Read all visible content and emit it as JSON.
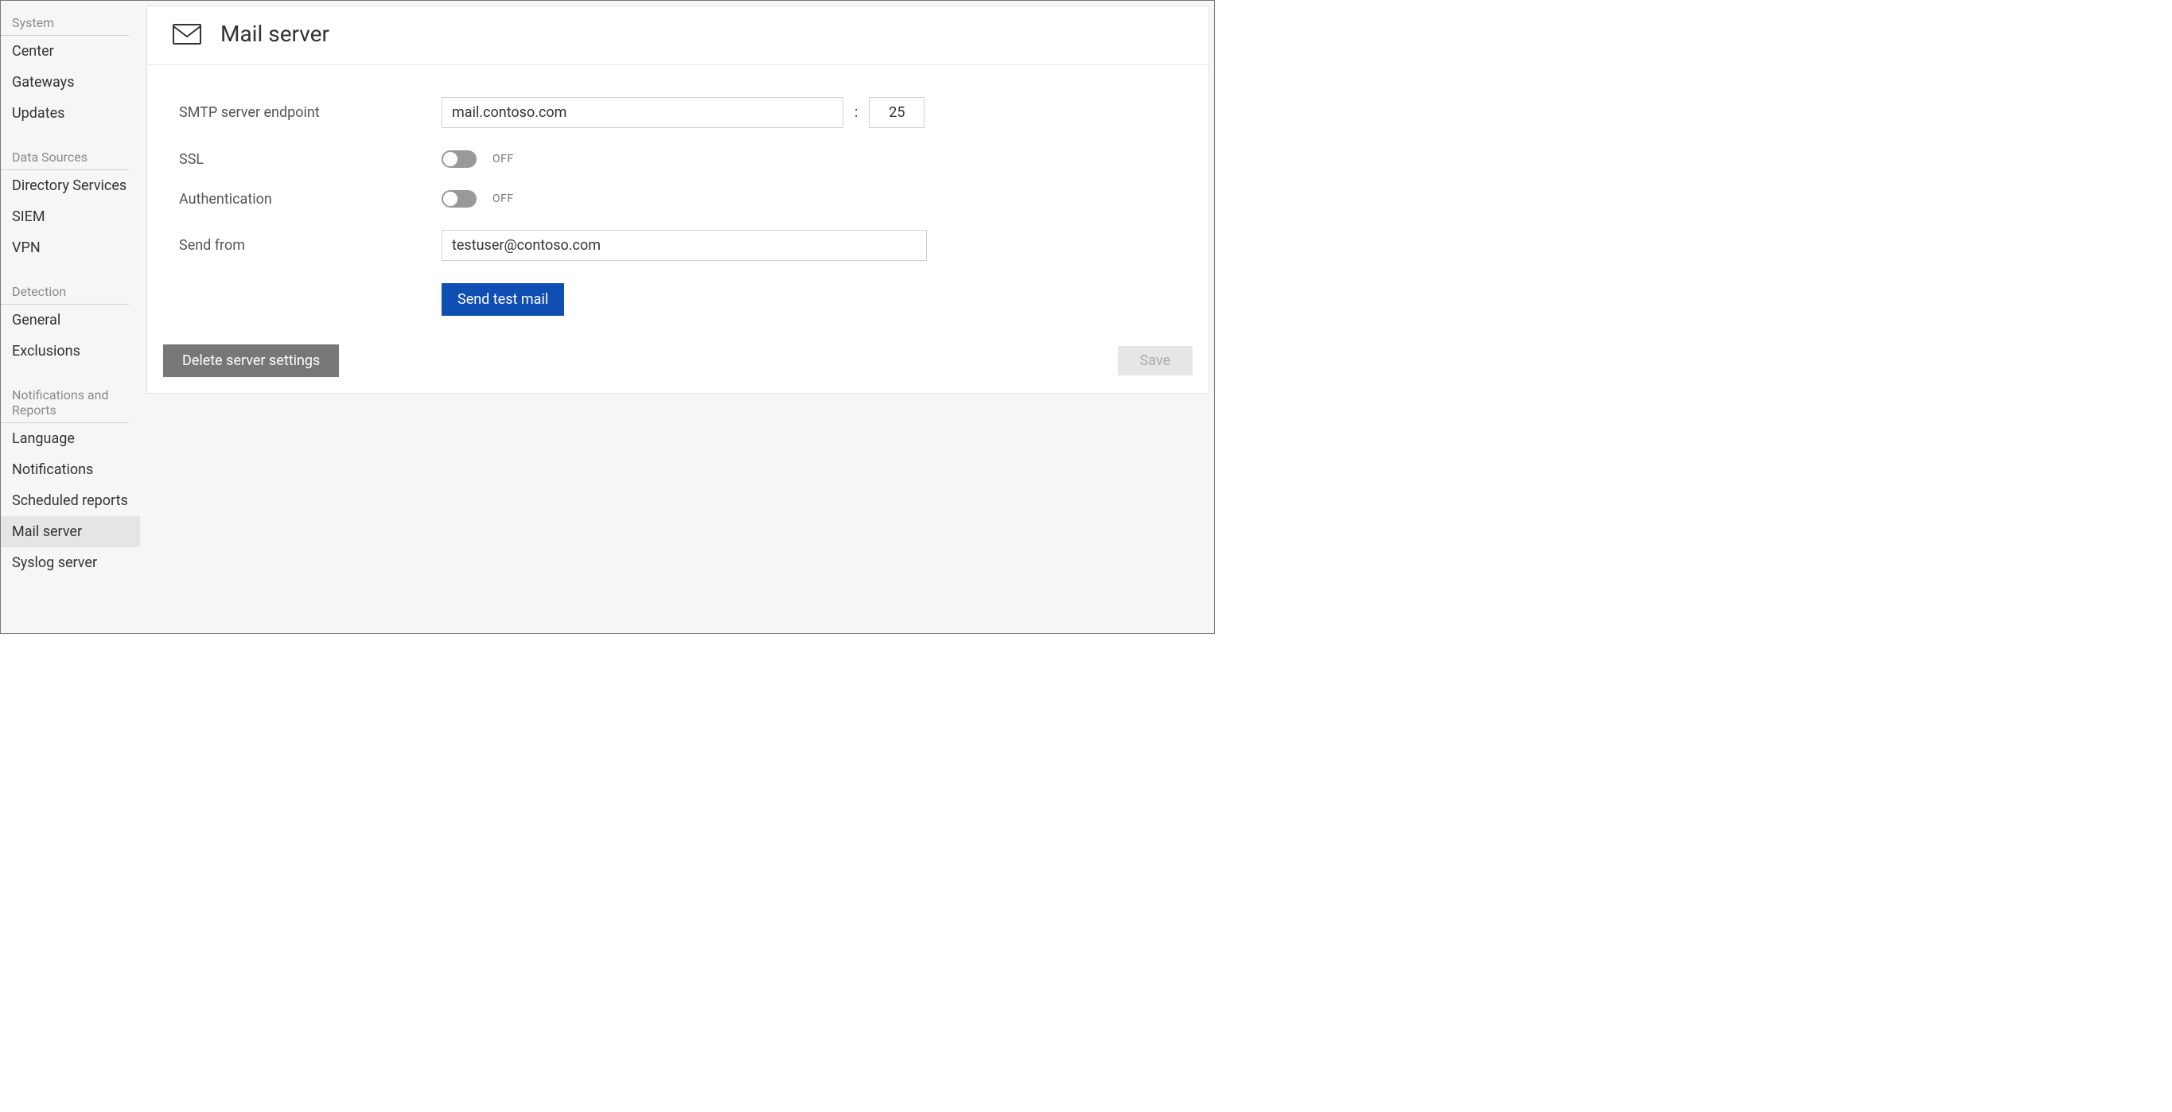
{
  "sidebar": {
    "groups": [
      {
        "title": "System",
        "items": [
          "Center",
          "Gateways",
          "Updates"
        ]
      },
      {
        "title": "Data Sources",
        "items": [
          "Directory Services",
          "SIEM",
          "VPN"
        ]
      },
      {
        "title": "Detection",
        "items": [
          "General",
          "Exclusions"
        ]
      },
      {
        "title": "Notifications and Reports",
        "items": [
          "Language",
          "Notifications",
          "Scheduled reports",
          "Mail server",
          "Syslog server"
        ]
      }
    ],
    "active": "Mail server"
  },
  "page": {
    "title": "Mail server",
    "labels": {
      "smtp": "SMTP server endpoint",
      "ssl": "SSL",
      "auth": "Authentication",
      "sendfrom": "Send from"
    },
    "values": {
      "smtp_host": "mail.contoso.com",
      "smtp_port": "25",
      "ssl_state": "OFF",
      "auth_state": "OFF",
      "sendfrom": "testuser@contoso.com"
    },
    "separator": ":",
    "buttons": {
      "test": "Send test mail",
      "delete": "Delete server settings",
      "save": "Save"
    }
  }
}
